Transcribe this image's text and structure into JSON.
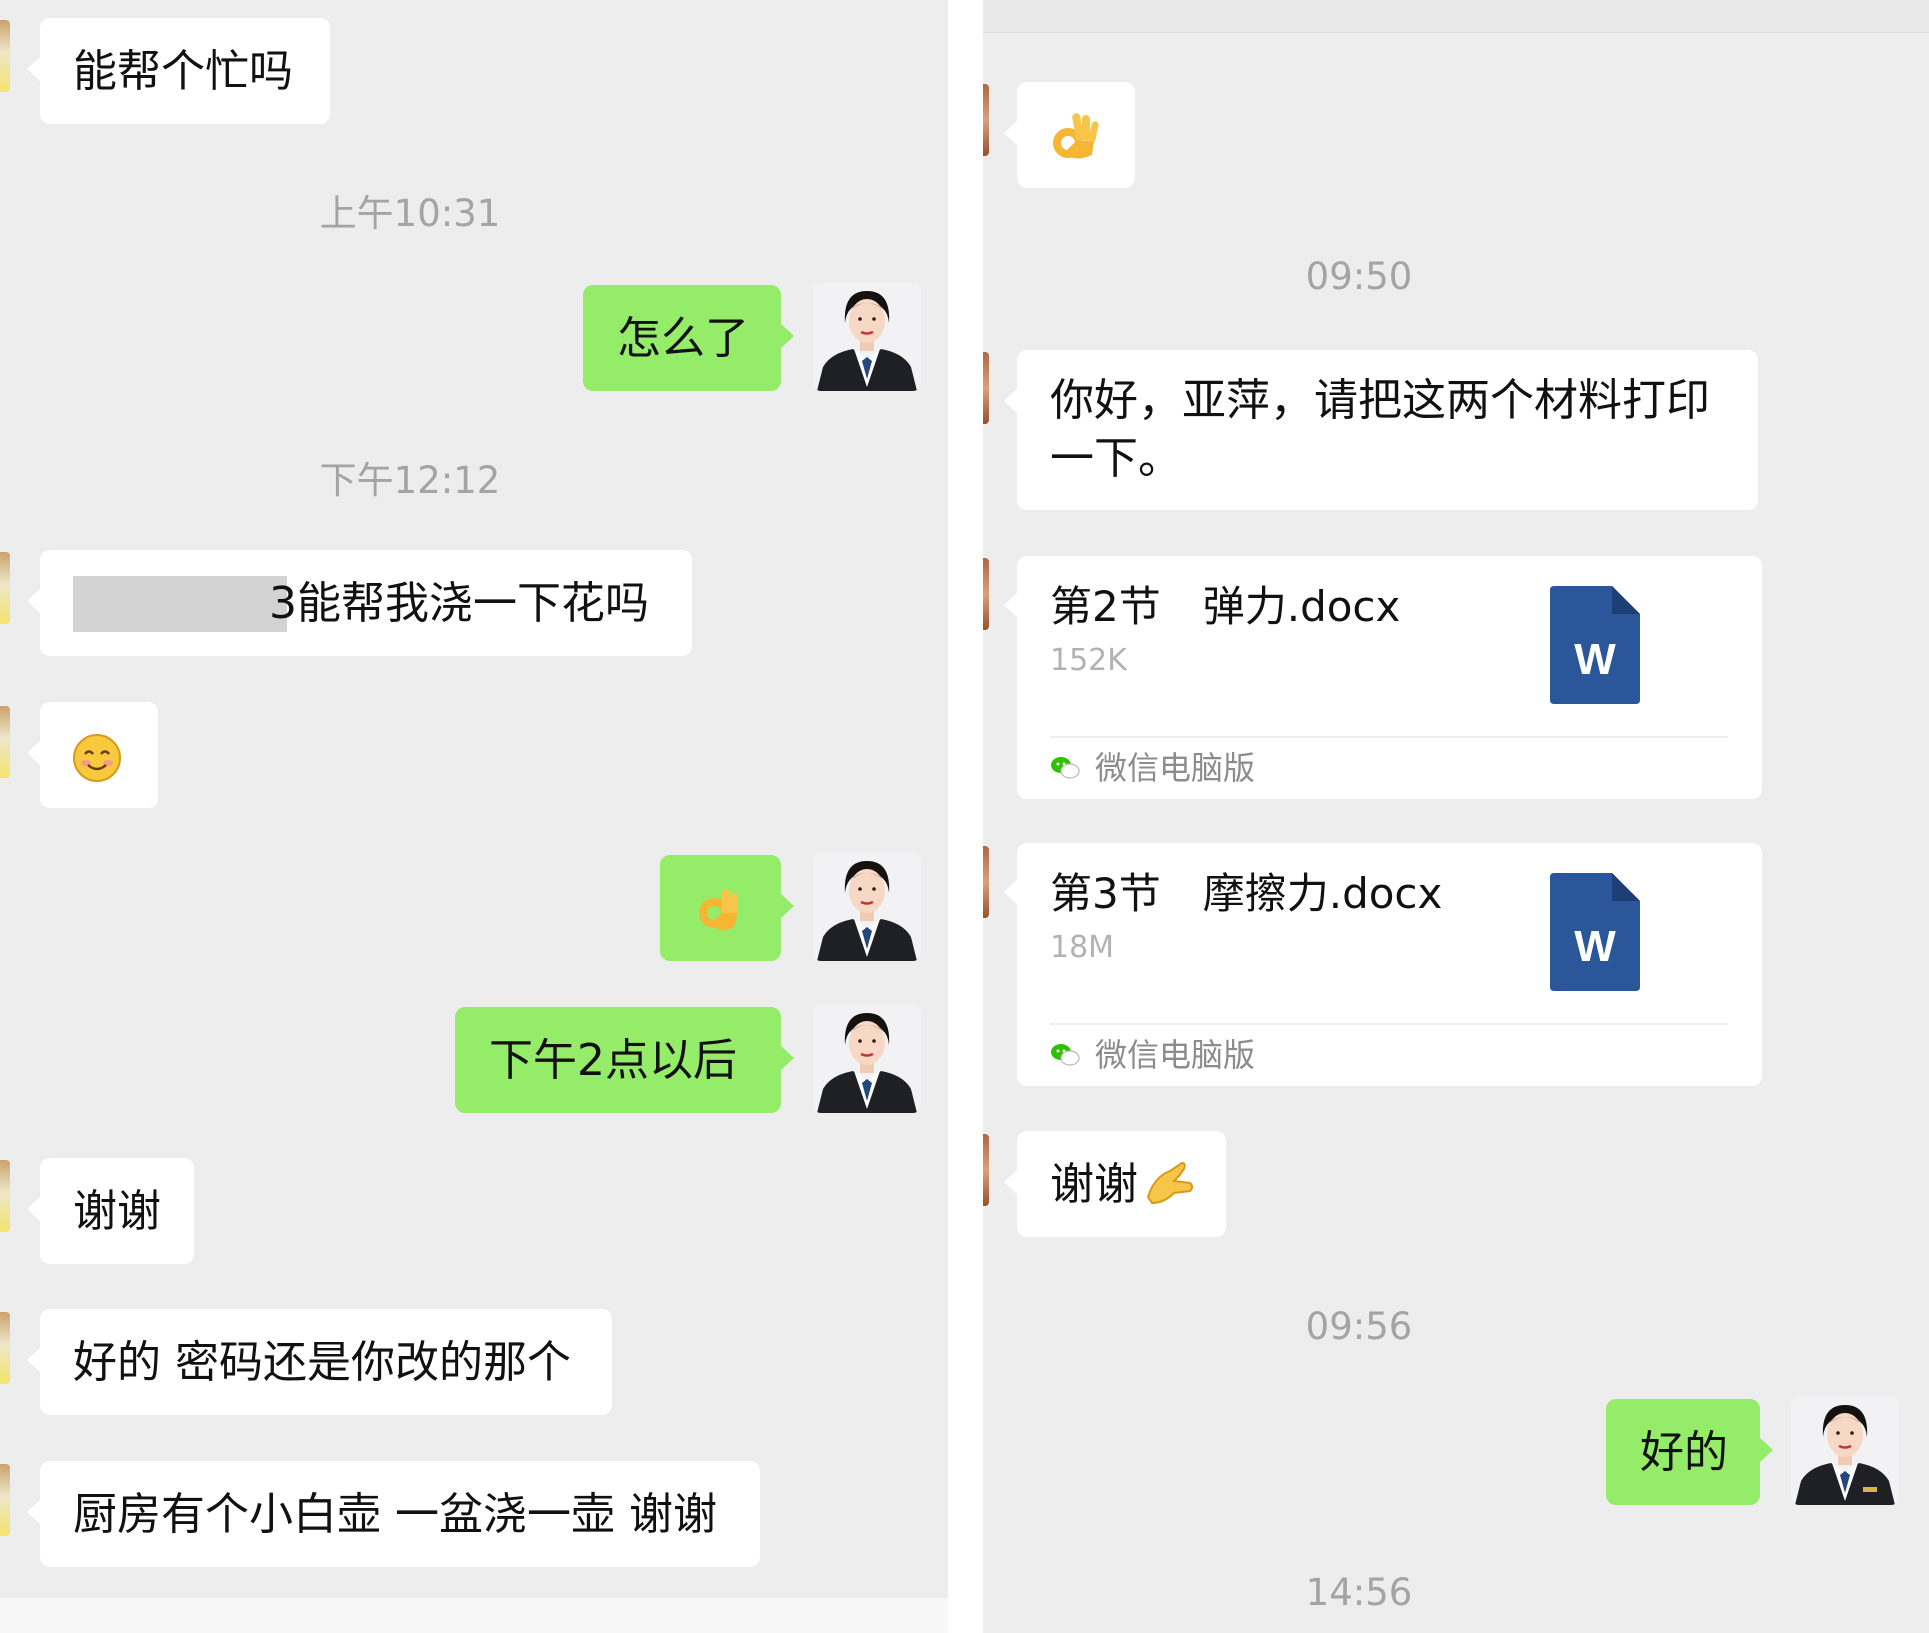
{
  "left_chat": {
    "messages": [
      {
        "from": "contact",
        "text": "能帮个忙吗"
      },
      {
        "time": "上午10:31"
      },
      {
        "from": "me",
        "text": "怎么了"
      },
      {
        "time": "下午12:12"
      },
      {
        "from": "contact",
        "text": "3能帮我浇一下花吗",
        "redacted_prefix": true
      },
      {
        "from": "contact",
        "emoji": "smiling-face-emoji"
      },
      {
        "from": "me",
        "emoji": "ok-hand-emoji"
      },
      {
        "from": "me",
        "text": "下午2点以后"
      },
      {
        "from": "contact",
        "text": "谢谢"
      },
      {
        "from": "contact",
        "text": "好的 密码还是你改的那个"
      },
      {
        "from": "contact",
        "text": "厨房有个小白壶 一盆浇一壶 谢谢"
      }
    ]
  },
  "right_chat": {
    "messages": [
      {
        "from": "contact",
        "emoji": "ok-hand-emoji"
      },
      {
        "time": "09:50"
      },
      {
        "from": "contact",
        "text": "你好，亚萍，请把这两个材料打印一下。"
      },
      {
        "from": "contact",
        "file": {
          "name": "第2节　弹力.docx",
          "size": "152K",
          "source": "微信电脑版",
          "icon": "word-file-icon",
          "icon_letter": "W"
        }
      },
      {
        "from": "contact",
        "file": {
          "name": "第3节　摩擦力.docx",
          "size": "18M",
          "source": "微信电脑版",
          "icon": "word-file-icon",
          "icon_letter": "W"
        }
      },
      {
        "from": "contact",
        "text": "谢谢",
        "emoji": "ok-hand-emoji"
      },
      {
        "time": "09:56"
      },
      {
        "from": "me",
        "text": "好的"
      },
      {
        "time": "14:56"
      }
    ]
  },
  "colors": {
    "chat_background": "#ededed",
    "incoming_bubble": "#ffffff",
    "outgoing_bubble": "#95ec69",
    "timestamp_text": "#a4a4a4",
    "word_icon": "#2b579a"
  }
}
